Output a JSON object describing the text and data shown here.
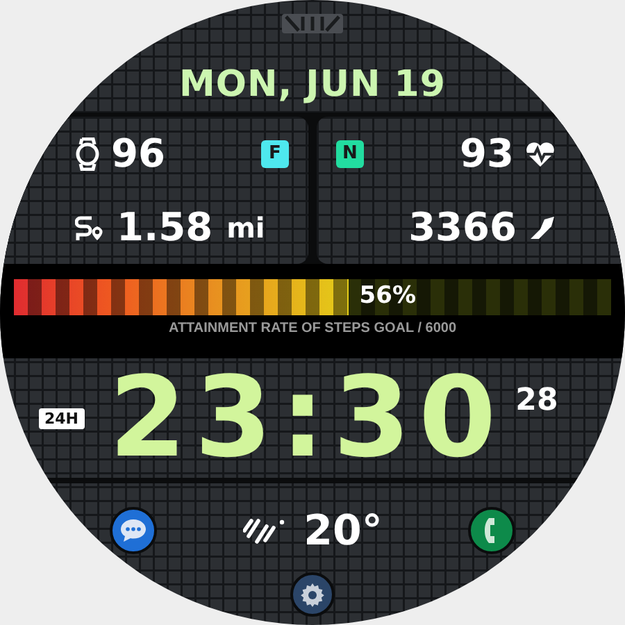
{
  "date": "MON, JUN 19",
  "left_panel": {
    "battery": "96",
    "badge": {
      "label": "F",
      "color": "#4ee8ee"
    },
    "distance": "1.58",
    "distance_unit": "mi"
  },
  "right_panel": {
    "badge": {
      "label": "N",
      "color": "#22dda0"
    },
    "heart_rate": "93",
    "steps": "3366"
  },
  "steps_goal": {
    "level": 0.56,
    "reading": "56%",
    "caption": "ATTAINMENT RATE OF STEPS GOAL / 6000"
  },
  "clock": {
    "format": "24H",
    "time": "23:30",
    "seconds": "28"
  },
  "weather": {
    "temperature": "20°"
  },
  "shortcuts": [
    {
      "kind": "messages"
    },
    {
      "kind": "phone"
    },
    {
      "kind": "settings"
    }
  ]
}
